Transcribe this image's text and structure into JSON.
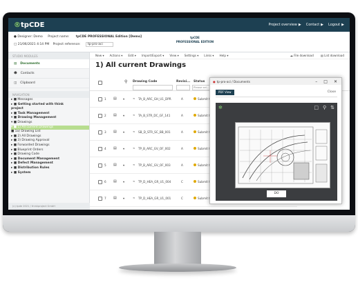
{
  "app": {
    "logo_prefix": "®",
    "logo_main": "tpCDE",
    "topnav": [
      "Project overview",
      "Contact",
      "Logout"
    ],
    "arrow": "▶"
  },
  "subbar": {
    "designer_label": "Designer: Demo",
    "project_label": "Project name:",
    "project_name": "tpCDE PROFESSIONAL Edition [Demo]",
    "date_text": "21/06/2021 4:14 PM",
    "project_ref": "Project reference:",
    "project_ref_value": "tp-pro-aci",
    "badge_line1": "tpCDE",
    "badge_line2": "PROFESSIONAL EDITION"
  },
  "sidebar": {
    "header1": "STUDIO MODULES",
    "items": [
      {
        "label": "Documents",
        "icon": "document-icon"
      },
      {
        "label": "Contacts",
        "icon": "users-icon"
      },
      {
        "label": "Clipboard",
        "icon": "clipboard-icon"
      }
    ],
    "header2": "NAVIGATION",
    "tree": [
      "▸ ■ Messages",
      "▸ ■ Getting started with think",
      "   project",
      "▸ ■ Task Management",
      "▾ ■ Drawing Management",
      "   ▾ ■ Drawings",
      "      ▾ ■ 1) All current Drawings",
      "         ■ 1a) Drawing List",
      "      ▸ ■ 2) All Drawings",
      "      ▸ ■ 3) Drawing Approval",
      "   ▸ ■ Forwarded Drawings",
      "   ▸ ■ Blueprint Orders",
      "   ▸ ■ Drawing Code",
      "▸ ■ Document Management",
      "▸ ■ Defect Management",
      "▸ ■ Distribution Rules",
      "▸ ■ System"
    ],
    "footer": "(c) tpde 2021 / thinkproject GmbH"
  },
  "toolbar": {
    "items": [
      "New ▾",
      "Actions ▾",
      "Edit ▾",
      "Import/Export ▾",
      "View ▾",
      "Settings ▾",
      "Links ▾",
      "Help ▾"
    ],
    "file_download": "File download",
    "list_download": "List download"
  },
  "page_title": "1) All current Drawings",
  "table": {
    "col_code": "Drawing Code",
    "col_rev": "Revisi...",
    "col_status": "Status",
    "status_placeholder": "Please sel...",
    "rows": [
      {
        "num": "1",
        "code": "TA_B_ARC_GH_U1_DPR",
        "rev": "A",
        "status": "Submit fo"
      },
      {
        "num": "2",
        "code": "TA_B_STR_DC_GF_141",
        "rev": "A",
        "status": "Submit fo"
      },
      {
        "num": "3",
        "code": "SB_D_STR_SC_BB_001",
        "rev": "A",
        "status": "Submit fo"
      },
      {
        "num": "4",
        "code": "TP_B_ARC_GV_OF_002",
        "rev": "A",
        "status": "Submit fo"
      },
      {
        "num": "5",
        "code": "TP_B_ARC_GV_OF_003",
        "rev": "A",
        "status": "Submit fo"
      },
      {
        "num": "6",
        "code": "TP_D_HEA_GR_U1_004",
        "rev": "C",
        "status": "Submit fo"
      },
      {
        "num": "7",
        "code": "TP_D_HEA_GR_U1_001",
        "rev": "C",
        "status": "Submit fo"
      }
    ]
  },
  "popup": {
    "title": "tp-pro-aci / Documents",
    "ctrl_min": "–",
    "ctrl_max": "□",
    "ctrl_close": "✕",
    "tab": "PDF View",
    "close_label": "Close",
    "download": "DO"
  }
}
